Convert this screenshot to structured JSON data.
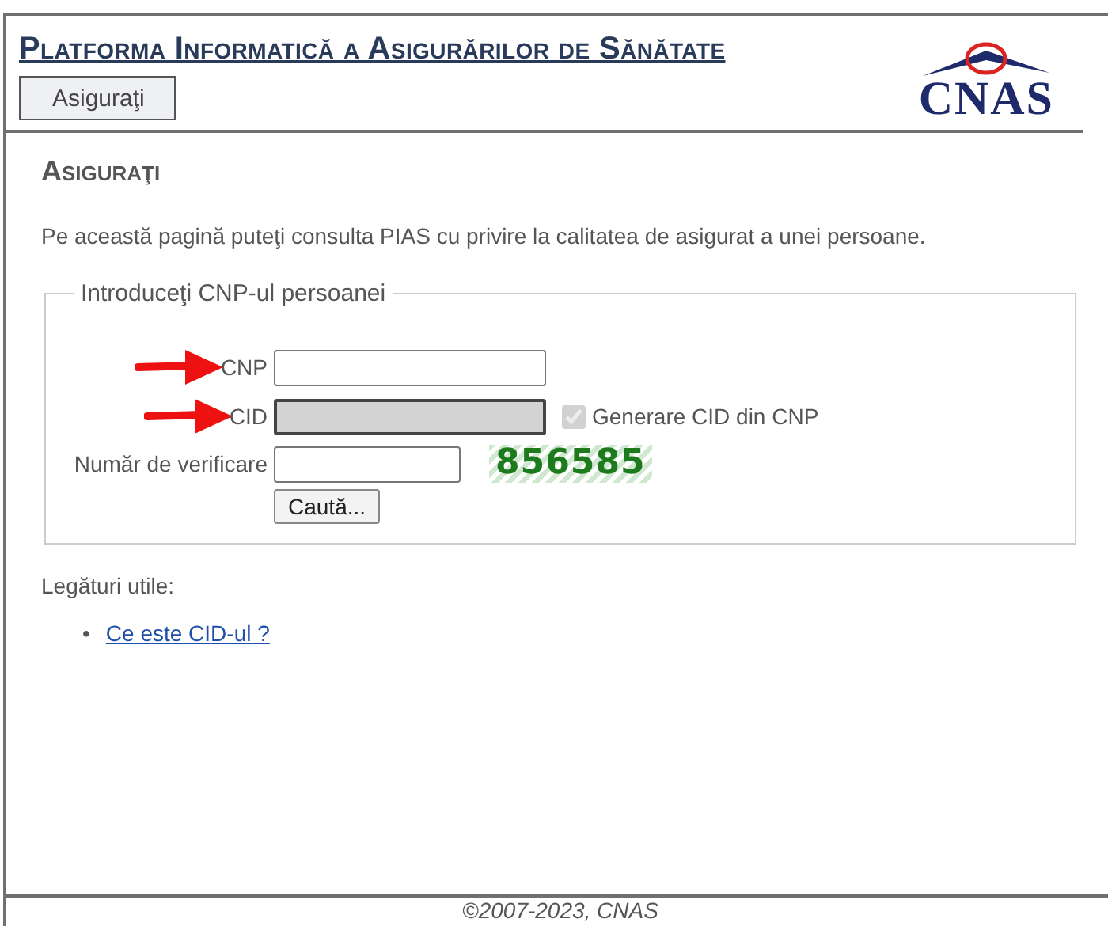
{
  "header": {
    "title": "Platforma Informatică a Asigurărilor de Sănătate",
    "nav_button": "Asiguraţi",
    "logo": "CNAS"
  },
  "page": {
    "heading": "Asiguraţi",
    "intro": "Pe această pagină puteţi consulta PIAS cu privire la calitatea de asigurat a unei persoane."
  },
  "form": {
    "legend": "Introduceţi CNP-ul persoanei",
    "fields": [
      {
        "label": "CNP",
        "arrow": true,
        "disabled": false,
        "kind": "long"
      },
      {
        "label": "CID",
        "arrow": true,
        "disabled": true,
        "kind": "long",
        "checkbox": {
          "label": "Generare CID din CNP",
          "checked": true,
          "disabled": true
        }
      },
      {
        "label": "Număr de verificare",
        "arrow": false,
        "disabled": false,
        "kind": "short",
        "captcha": "856585"
      }
    ],
    "submit": "Caută..."
  },
  "links": {
    "heading": "Legături utile:",
    "items": [
      {
        "bullet": "•",
        "text": "Ce este CID-ul ?"
      }
    ]
  },
  "footer": "©2007-2023, CNAS"
}
